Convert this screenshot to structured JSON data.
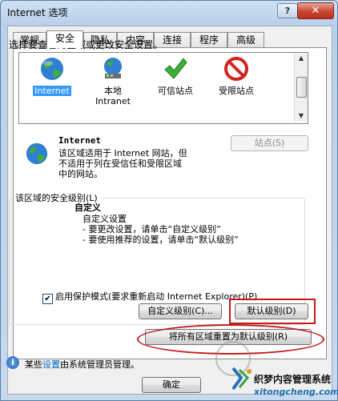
{
  "window": {
    "title": "Internet 选项",
    "help_label": "?",
    "close_label": "✕"
  },
  "tabs": [
    {
      "label": "常规"
    },
    {
      "label": "安全"
    },
    {
      "label": "隐私"
    },
    {
      "label": "内容"
    },
    {
      "label": "连接"
    },
    {
      "label": "程序"
    },
    {
      "label": "高级"
    }
  ],
  "security": {
    "prompt": "选择要查看的区域或更改安全设置。",
    "zones": [
      {
        "label": "Internet",
        "icon": "globe-icon",
        "selected": true
      },
      {
        "label": "本地",
        "label2": "Intranet",
        "icon": "network-globe-icon"
      },
      {
        "label": "可信站点",
        "icon": "checkmark-icon"
      },
      {
        "label": "受限站点",
        "icon": "no-entry-icon"
      }
    ],
    "zone_info": {
      "title": "Internet",
      "desc": [
        "该区域适用于 Internet 网站，但",
        "不适用于列在受信任和受限区域",
        "中的网站。"
      ]
    },
    "sites_button": "站点(S)",
    "level_group": "该区域的安全级别(L)",
    "level": {
      "title": "自定义",
      "lines": [
        "自定义设置",
        "- 要更改设置，请单击“自定义级别”",
        "- 要使用推荐的设置，请单击“默认级别”"
      ]
    },
    "protected_mode": {
      "label": "启用保护模式(要求重新启动 Internet Explorer)(P)",
      "checked": true
    },
    "custom_level_button": "自定义级别(C)...",
    "default_level_button": "默认级别(D)",
    "reset_all_button": "将所有区域重置为默认级别(R)"
  },
  "admin_note": {
    "prefix": "某些",
    "link": "设置",
    "suffix": "由系统管理员管理。"
  },
  "footer": {
    "ok_button": "确定"
  },
  "watermark": {
    "line1": "织梦内容管理系统",
    "line2": "xitongcheng.com"
  },
  "colors": {
    "highlight": "#c41a1a",
    "selection": "#3399ff",
    "link": "#0066cc"
  }
}
